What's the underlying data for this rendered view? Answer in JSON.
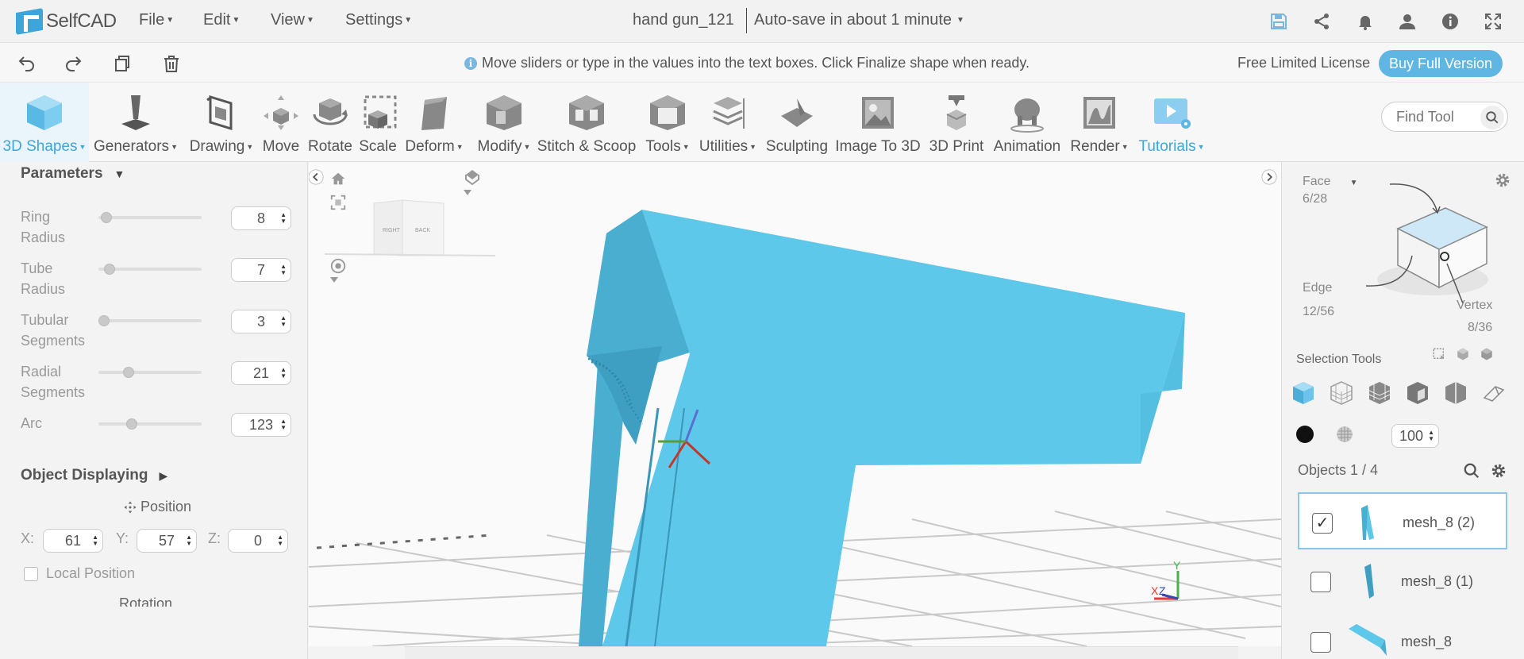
{
  "app": {
    "name": "SelfCAD",
    "menu": [
      "File",
      "Edit",
      "View",
      "Settings"
    ],
    "doc_title": "hand gun_121",
    "autosave": "Auto-save in about 1 minute",
    "top_icons": [
      "save-icon",
      "share-icon",
      "bell-icon",
      "user-icon",
      "info-icon",
      "fullscreen-icon"
    ]
  },
  "actionbar": {
    "icons": [
      "undo-icon",
      "redo-icon",
      "copy-icon",
      "trash-icon"
    ],
    "hint": "Move sliders or type in the values into the text boxes. Click Finalize shape when ready.",
    "license": "Free Limited License",
    "buy_label": "Buy Full Version"
  },
  "toolbar": {
    "tools": [
      {
        "label": "3D Shapes",
        "caret": true
      },
      {
        "label": "Generators",
        "caret": true
      },
      {
        "label": "Drawing",
        "caret": true
      },
      {
        "label": "Move",
        "caret": false
      },
      {
        "label": "Rotate",
        "caret": false
      },
      {
        "label": "Scale",
        "caret": false
      },
      {
        "label": "Deform",
        "caret": true
      },
      {
        "label": "Modify",
        "caret": true
      },
      {
        "label": "Stitch & Scoop",
        "caret": false
      },
      {
        "label": "Tools",
        "caret": true
      },
      {
        "label": "Utilities",
        "caret": true
      },
      {
        "label": "Sculpting",
        "caret": false
      },
      {
        "label": "Image To 3D",
        "caret": false
      },
      {
        "label": "3D Print",
        "caret": false
      },
      {
        "label": "Animation",
        "caret": false
      },
      {
        "label": "Render",
        "caret": true
      },
      {
        "label": "Tutorials",
        "caret": true
      }
    ],
    "find_placeholder": "Find Tool"
  },
  "left": {
    "parameters_title": "Parameters",
    "params": [
      {
        "label": "Ring Radius",
        "value": "8",
        "slider": 0.03
      },
      {
        "label": "Tube Radius",
        "value": "7",
        "slider": 0.06
      },
      {
        "label": "Tubular Segments",
        "value": "3",
        "slider": 0.0
      },
      {
        "label": "Radial Segments",
        "value": "21",
        "slider": 0.27
      },
      {
        "label": "Arc",
        "value": "123",
        "slider": 0.3
      }
    ],
    "object_displaying": "Object Displaying",
    "position_label": "Position",
    "coords": [
      {
        "label": "X:",
        "value": "61"
      },
      {
        "label": "Y:",
        "value": "57"
      },
      {
        "label": "Z:",
        "value": "0"
      }
    ],
    "local_position": "Local Position",
    "rotation_label": "Rotation"
  },
  "viewport": {
    "cube_faces": [
      "RIGHT",
      "BACK"
    ],
    "axis_labels": [
      "Y",
      "X",
      "Z"
    ]
  },
  "right": {
    "face_label": "Face",
    "face_count": "6/28",
    "edge_label": "Edge",
    "edge_count": "12/56",
    "vertex_label": "Vertex",
    "vertex_count": "8/36",
    "selection_tools": "Selection Tools",
    "opacity": "100",
    "objects_title": "Objects 1 / 4",
    "objects": [
      {
        "name": "mesh_8 (2)",
        "checked": true
      },
      {
        "name": "mesh_8 (1)",
        "checked": false
      },
      {
        "name": "mesh_8",
        "checked": false
      }
    ]
  },
  "colors": {
    "accent": "#3ea6da",
    "model": "#5ec8ea",
    "model_dark": "#4aaed0"
  }
}
